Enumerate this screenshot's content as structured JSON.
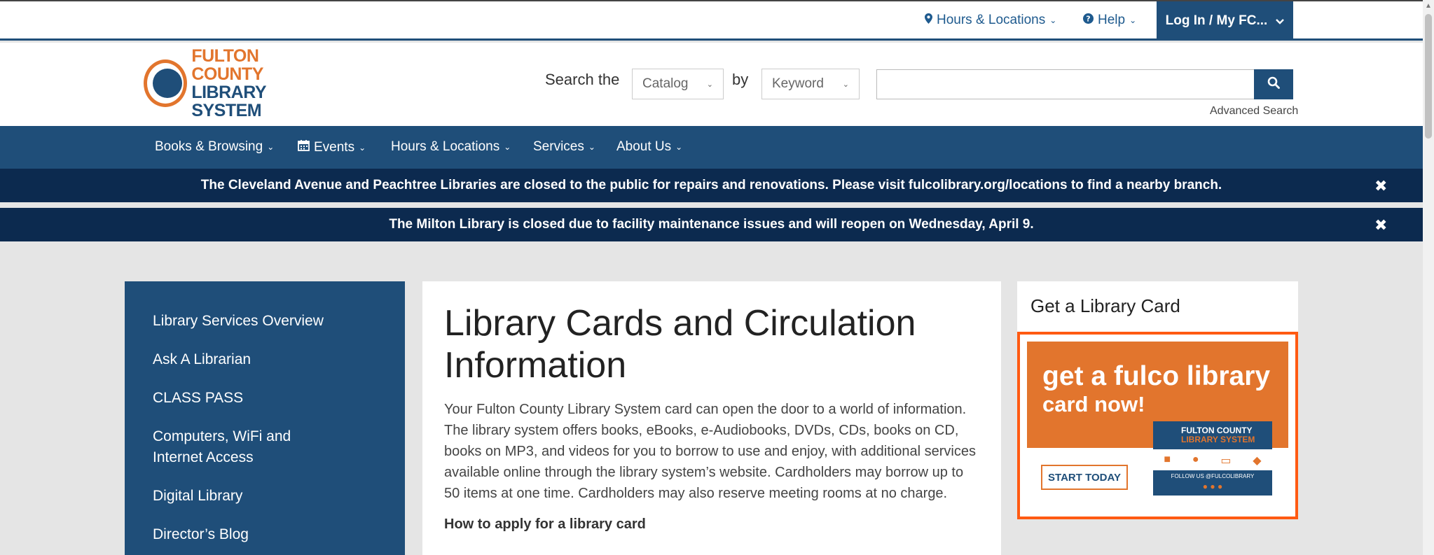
{
  "utility": {
    "hours_label": "Hours & Locations",
    "help_label": "Help",
    "login_label": "Log In / My FC..."
  },
  "header": {
    "logo_line1": "FULTON COUNTY",
    "logo_line2": "LIBRARY SYSTEM",
    "search_prefix": "Search the",
    "catalog_select": "Catalog",
    "by_label": "by",
    "keyword_select": "Keyword",
    "search_value": "",
    "advanced_search": "Advanced Search"
  },
  "nav": {
    "items": [
      {
        "label": "Books & Browsing"
      },
      {
        "label": "Events"
      },
      {
        "label": "Hours & Locations"
      },
      {
        "label": "Services"
      },
      {
        "label": "About Us"
      }
    ]
  },
  "alerts": [
    {
      "text": "The Cleveland Avenue and Peachtree Libraries are closed to the public for repairs and renovations.  Please visit fulcolibrary.org/locations to find a nearby branch."
    },
    {
      "text": "The Milton Library is closed due to facility maintenance issues and will reopen on Wednesday, April 9."
    }
  ],
  "sidebar": {
    "items": [
      {
        "label": "Library Services Overview"
      },
      {
        "label": "Ask A Librarian"
      },
      {
        "label": "CLASS PASS"
      },
      {
        "label": "Computers, WiFi and Internet Access"
      },
      {
        "label": "Digital Library"
      },
      {
        "label": "Director’s Blog"
      }
    ]
  },
  "main": {
    "title": "Library Cards and Circulation Information",
    "body": "Your Fulton County Library System card can open the door to a world of information. The library system offers books, eBooks, e-Audiobooks, DVDs, CDs, books on CD, books on MP3, and videos for you to borrow to use and enjoy, with additional services available online through the library system’s website. Cardholders may borrow up to 50 items at one time. Cardholders may also reserve meeting rooms at no charge.",
    "subheading": "How to apply for a library card"
  },
  "right_panel": {
    "title": "Get a Library Card",
    "promo_big": "get a fulco library",
    "promo_now": "card now!",
    "promo_logo_line1": "FULTON COUNTY",
    "promo_logo_line2": "LIBRARY SYSTEM",
    "promo_follow": "FOLLOW US @FULCOLIBRARY",
    "promo_cta": "START TODAY"
  },
  "colors": {
    "brand_blue": "#1f4e79",
    "brand_orange": "#e2752d",
    "alert_bg": "#0c2a4f",
    "card_border": "#ff5a12"
  }
}
